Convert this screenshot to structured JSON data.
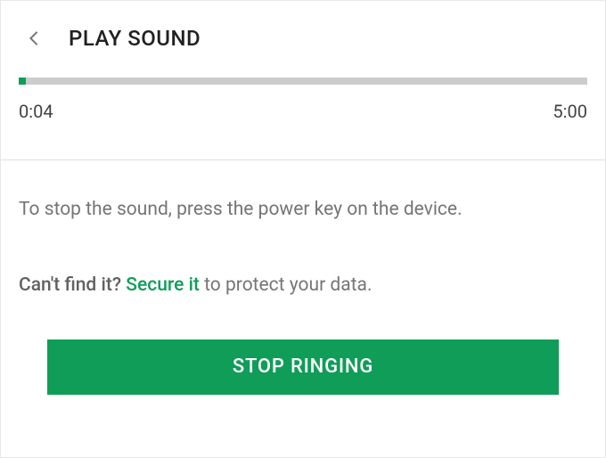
{
  "header": {
    "title": "PLAY SOUND"
  },
  "progress": {
    "elapsed": "0:04",
    "total": "5:00",
    "percent": 1.33
  },
  "instruction": "To stop the sound, press the power key on the device.",
  "secondary": {
    "lead": "Can't find it?",
    "link_text": "Secure it",
    "after": " to protect your data."
  },
  "actions": {
    "stop_label": "STOP RINGING"
  },
  "colors": {
    "accent": "#0F9D58"
  }
}
